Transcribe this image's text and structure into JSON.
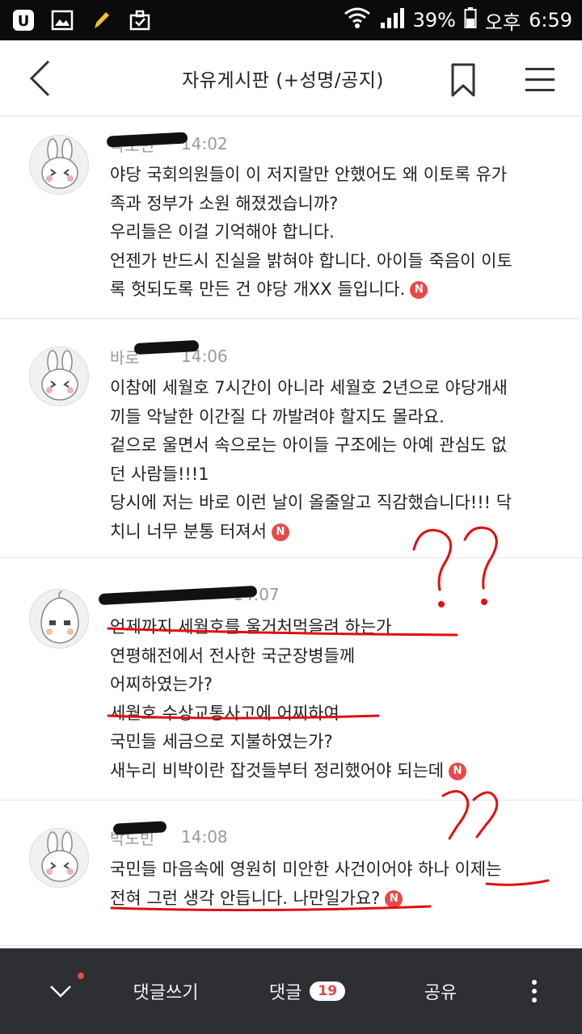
{
  "status_bar": {
    "battery": "39%",
    "ampm": "오후",
    "time": "6:59",
    "left_icons": [
      "u-plus-icon",
      "gallery-icon",
      "pencil-icon",
      "briefcase-icon"
    ]
  },
  "header": {
    "title": "자유게시판 (+성명/공지)"
  },
  "comments": [
    {
      "author": "박도빈",
      "time": "14:02",
      "lines": [
        "야당 국회의원들이 이 저지랄만 안했어도 왜 이토록 유가",
        "족과 정부가 소원 해졌겠습니까?",
        "우리들은 이걸 기억해야 합니다.",
        "언젠가 반드시 진실을 밝혀야 합니다. 아이들 죽음이 이토",
        "록 헛되도록 만든 건 야당 개XX 들입니다."
      ],
      "badge": "N"
    },
    {
      "author": "바로",
      "time": "14:06",
      "lines": [
        "이참에 세월호 7시간이 아니라 세월호 2년으로 야당개새",
        "끼들 악날한 이간질 다 까발려야 할지도 몰라요.",
        "겉으로 울면서 속으로는 아이들 구조에는 아예 관심도 없",
        "던 사람들!!!1",
        "당시에 저는 바로 이런 날이 올줄알고 직감했습니다!!! 닥",
        "치니 너무 분통 터져서"
      ],
      "badge": "N"
    },
    {
      "author": "",
      "time": "14:07",
      "lines": [
        "언제까지 세월호를 울거처먹을려 하는가",
        "연평해전에서 전사한 국군장병들께",
        "어찌하였는가?",
        "세월호 수상교통사고에 어찌하여",
        "국민들 세금으로 지불하였는가?",
        "새누리 비박이란 잡것들부터 정리했어야 되는데"
      ],
      "badge": "N"
    },
    {
      "author": "박도빈",
      "time": "14:08",
      "lines": [
        "국민들 마음속에 영원히 미안한 사건이어야 하나 이제는",
        "전혀 그런 생각 안듭니다. 나만일가요?"
      ],
      "badge": "N"
    }
  ],
  "bottom_bar": {
    "write_label": "댓글쓰기",
    "comments_label": "댓글",
    "comments_count": "19",
    "share_label": "공유"
  },
  "colors": {
    "accent_red": "#e84a4a",
    "bottom_bar_bg": "#2e2f32",
    "annotation_red": "#e01010"
  }
}
